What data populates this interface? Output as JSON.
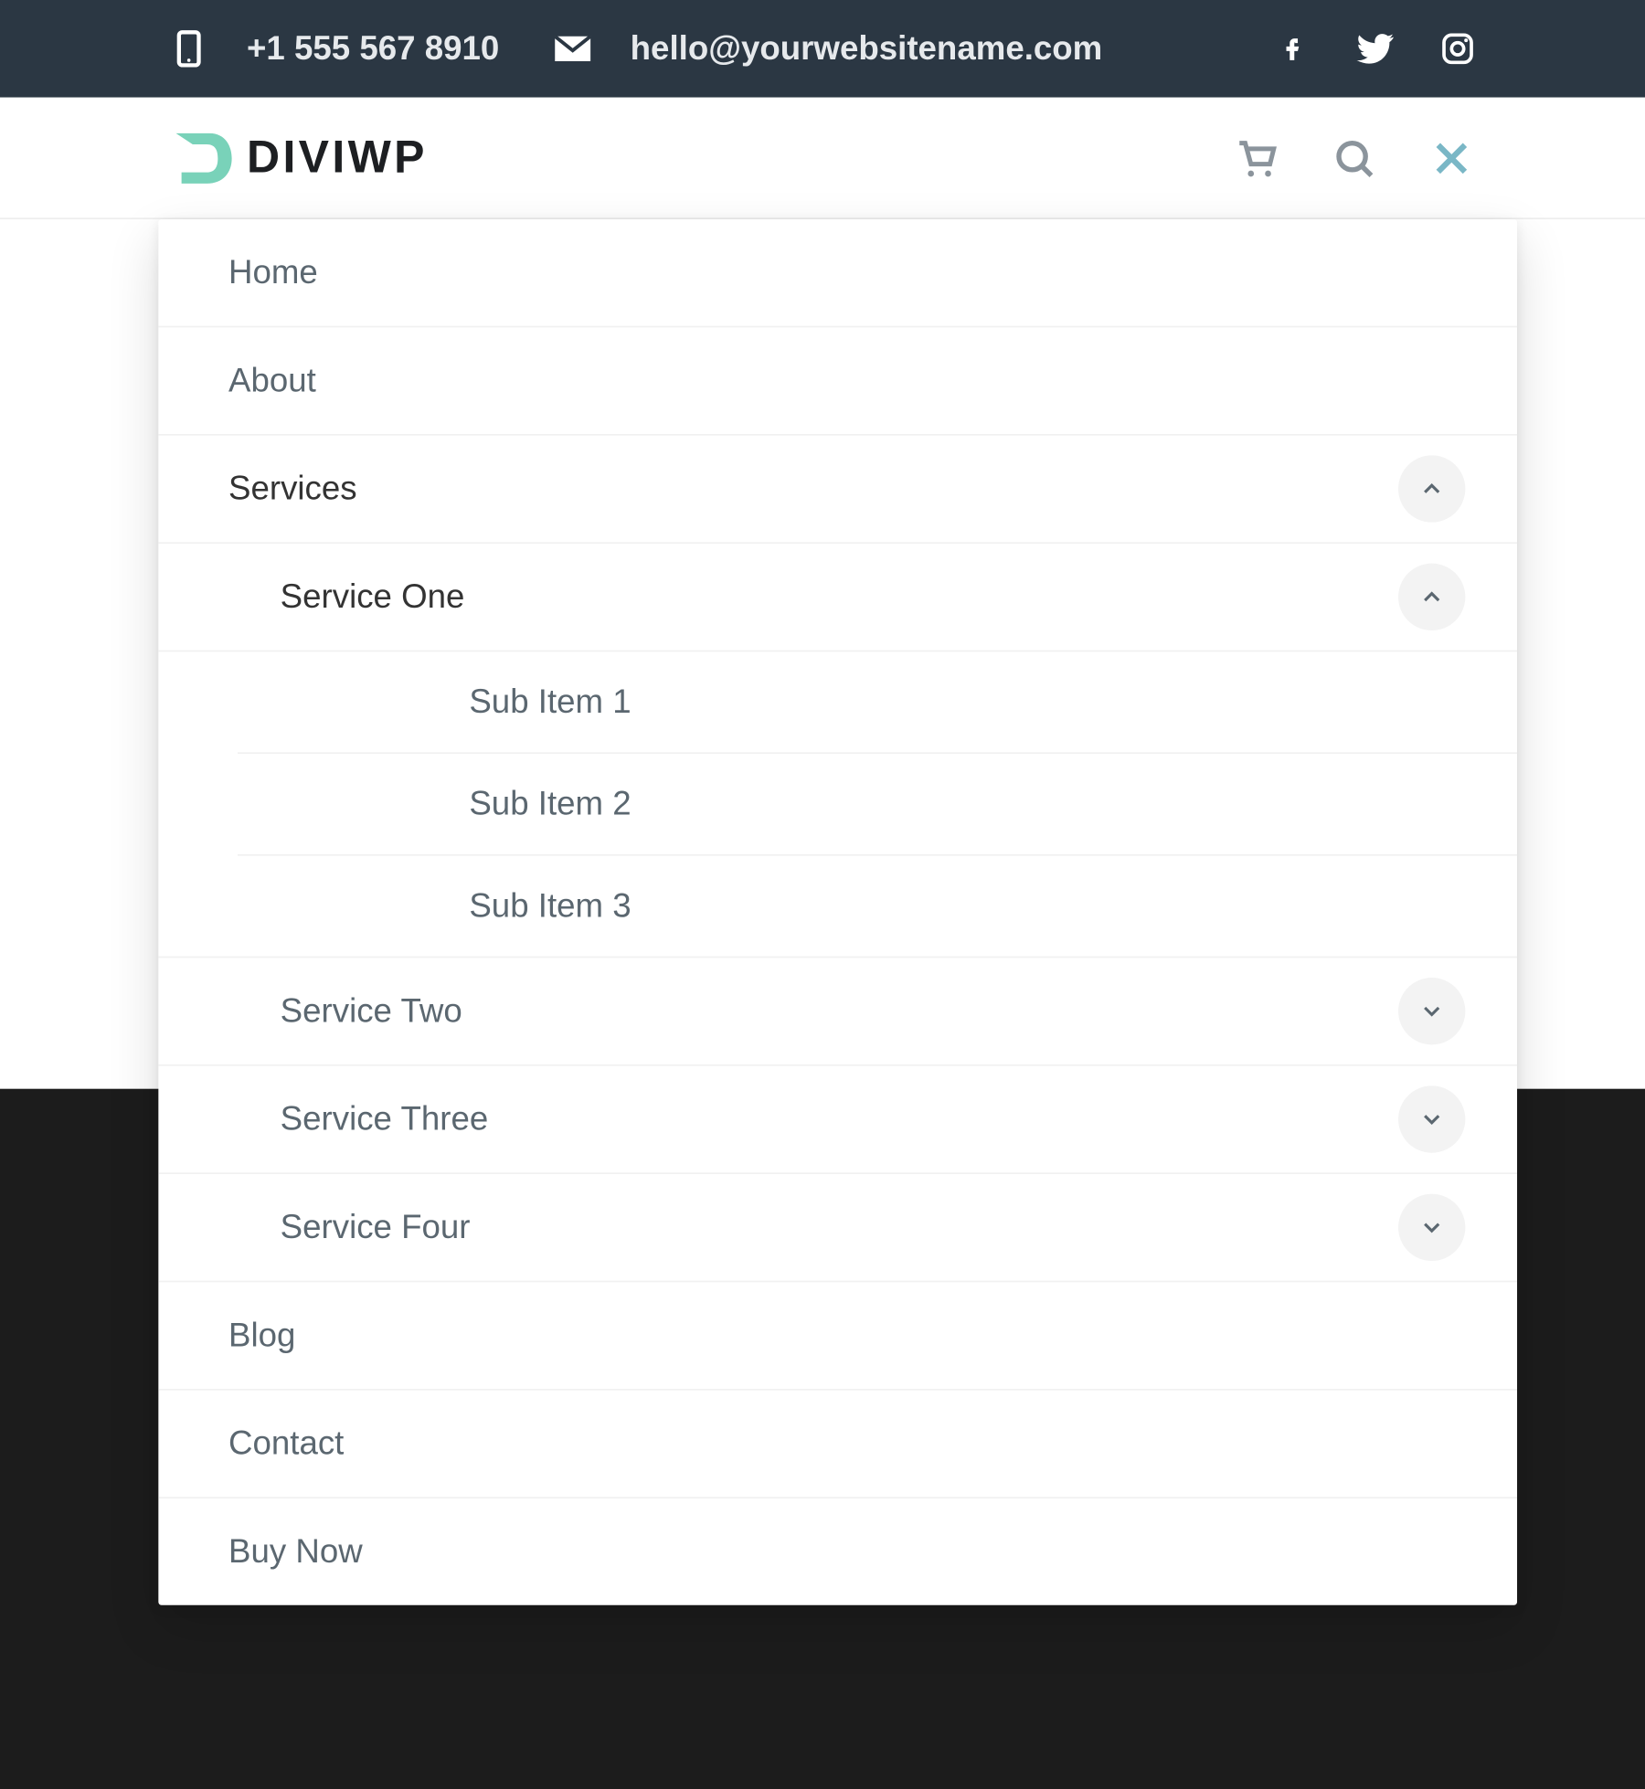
{
  "topbar": {
    "phone": "+1 555 567 8910",
    "email": "hello@yourwebsitename.com",
    "phone_icon": "phone-icon",
    "email_icon": "mail-icon",
    "socials": [
      "facebook",
      "twitter",
      "instagram"
    ]
  },
  "header": {
    "logo_divi": "DIVI",
    "logo_wp": "WP",
    "icons": {
      "cart": "cart-icon",
      "search": "search-icon",
      "close": "close-icon"
    }
  },
  "menu": {
    "items": [
      {
        "label": "Home"
      },
      {
        "label": "About"
      },
      {
        "label": "Services",
        "expanded": true,
        "children": [
          {
            "label": "Service One",
            "expanded": true,
            "children": [
              {
                "label": "Sub Item 1"
              },
              {
                "label": "Sub Item 2"
              },
              {
                "label": "Sub Item 3"
              }
            ]
          },
          {
            "label": "Service Two",
            "expanded": false
          },
          {
            "label": "Service Three",
            "expanded": false
          },
          {
            "label": "Service Four",
            "expanded": false
          }
        ]
      },
      {
        "label": "Blog"
      },
      {
        "label": "Contact"
      },
      {
        "label": "Buy Now"
      }
    ]
  }
}
